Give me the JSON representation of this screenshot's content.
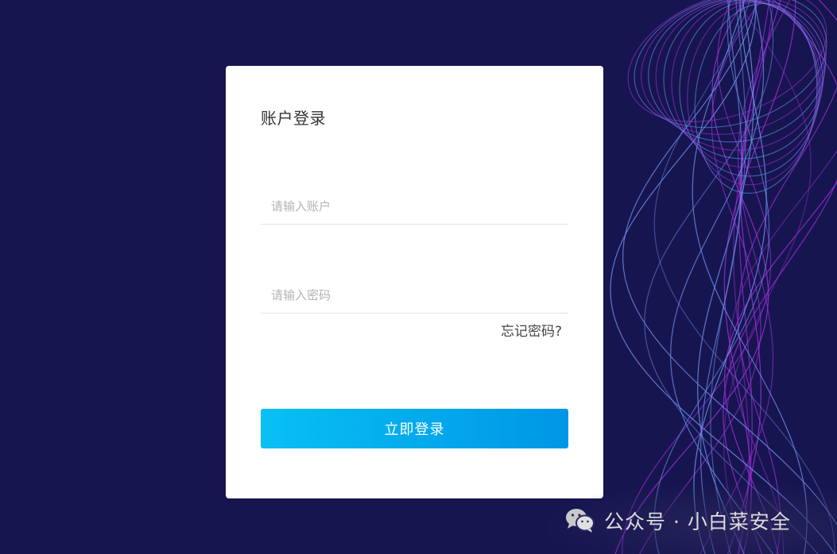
{
  "login_card": {
    "title": "账户登录",
    "account_placeholder": "请输入账户",
    "password_placeholder": "请输入密码",
    "forgot_password": "忘记密码?",
    "submit_label": "立即登录"
  },
  "watermark": {
    "icon": "wechat-icon",
    "text": "公众号 · 小白菜安全"
  },
  "colors": {
    "background": "#171550",
    "button_start": "#08c0f3",
    "button_end": "#0096e6",
    "wave_purple": "#9b2fd6",
    "wave_blue": "#6b8fe8"
  }
}
